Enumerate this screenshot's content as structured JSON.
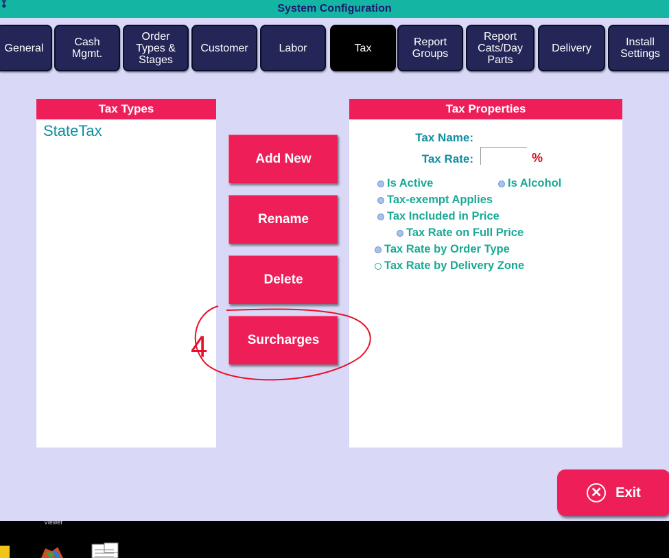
{
  "window": {
    "title": "System Configuration"
  },
  "tabs": [
    {
      "label": "General"
    },
    {
      "label": "Cash\nMgmt."
    },
    {
      "label": "Order\nTypes &\nStages"
    },
    {
      "label": "Customer"
    },
    {
      "label": "Labor"
    },
    {
      "label": "Tax",
      "active": true
    },
    {
      "label": "Report\nGroups"
    },
    {
      "label": "Report\nCats/Day\nParts"
    },
    {
      "label": "Delivery"
    },
    {
      "label": "Install\nSettings"
    }
  ],
  "tax_types": {
    "header": "Tax Types",
    "items": [
      "StateTax"
    ]
  },
  "actions": {
    "add_new": "Add New",
    "rename": "Rename",
    "delete": "Delete",
    "surcharges": "Surcharges"
  },
  "tax_properties": {
    "header": "Tax Properties",
    "name_label": "Tax Name:",
    "rate_label": "Tax Rate:",
    "rate_value": "",
    "percent_symbol": "%",
    "options": {
      "is_active": "Is Active",
      "is_alcohol": "Is Alcohol",
      "tax_exempt": "Tax-exempt Applies",
      "tax_included": "Tax Included in Price",
      "full_price": "Tax Rate on Full Price",
      "by_order_type": "Tax Rate by Order Type",
      "by_delivery_zone": "Tax Rate by Delivery Zone"
    }
  },
  "exit": {
    "label": "Exit"
  },
  "taskbar": {
    "viewer_label": "Viewer"
  },
  "annotation": {
    "number": "4",
    "color": "#e8102a"
  },
  "colors": {
    "accent": "#ee1f58",
    "tab_bg": "#242657",
    "titlebar": "#15b5a4",
    "background": "#d9d9f7",
    "text_teal": "#0f8ea2"
  }
}
